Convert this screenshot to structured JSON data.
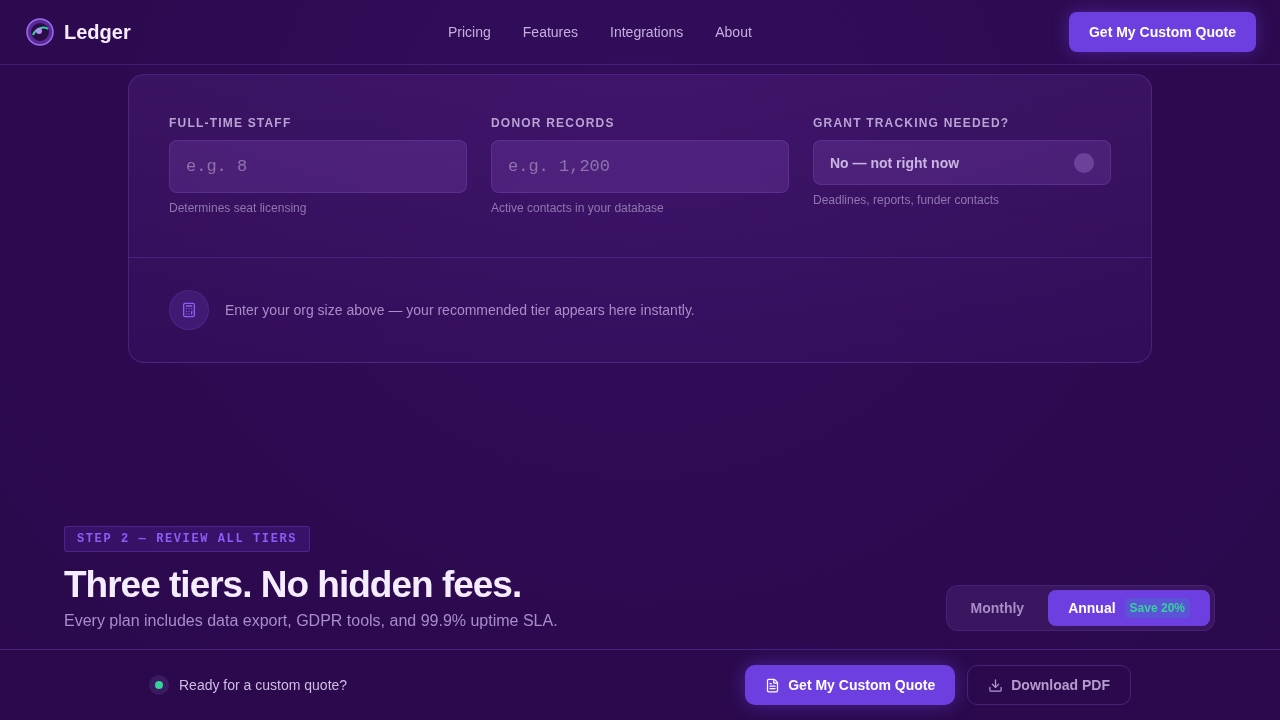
{
  "header": {
    "brand": "Ledger",
    "nav": [
      {
        "label": "Pricing"
      },
      {
        "label": "Features"
      },
      {
        "label": "Integrations"
      },
      {
        "label": "About"
      }
    ],
    "cta": "Get My Custom Quote"
  },
  "estimator": {
    "fields": [
      {
        "kind": "input",
        "label": "FULL-TIME STAFF",
        "placeholder": "e.g. 8",
        "hint": "Determines seat licensing"
      },
      {
        "kind": "input",
        "label": "DONOR RECORDS",
        "placeholder": "e.g. 1,200",
        "hint": "Active contacts in your database"
      },
      {
        "kind": "toggle",
        "label": "GRANT TRACKING NEEDED?",
        "value": "No — not right now",
        "on": false,
        "hint": "Deadlines, reports, funder contacts"
      }
    ],
    "result_message": "Enter your org size above — your recommended tier appears here instantly."
  },
  "tiers_intro": {
    "step": "STEP 2 — REVIEW ALL TIERS",
    "title": "Three tiers. No hidden fees.",
    "subtitle": "Every plan includes data export, GDPR tools, and 99.9% uptime SLA.",
    "billing": [
      {
        "label": "Monthly",
        "selected": false
      },
      {
        "label": "Annual",
        "selected": true,
        "badge": "Save 20%"
      }
    ]
  },
  "quote_bar": {
    "status": "Ready for a custom quote?",
    "actions": [
      {
        "kind": "primary",
        "label": "Get My Custom Quote"
      },
      {
        "kind": "secondary",
        "label": "Download PDF"
      }
    ]
  }
}
